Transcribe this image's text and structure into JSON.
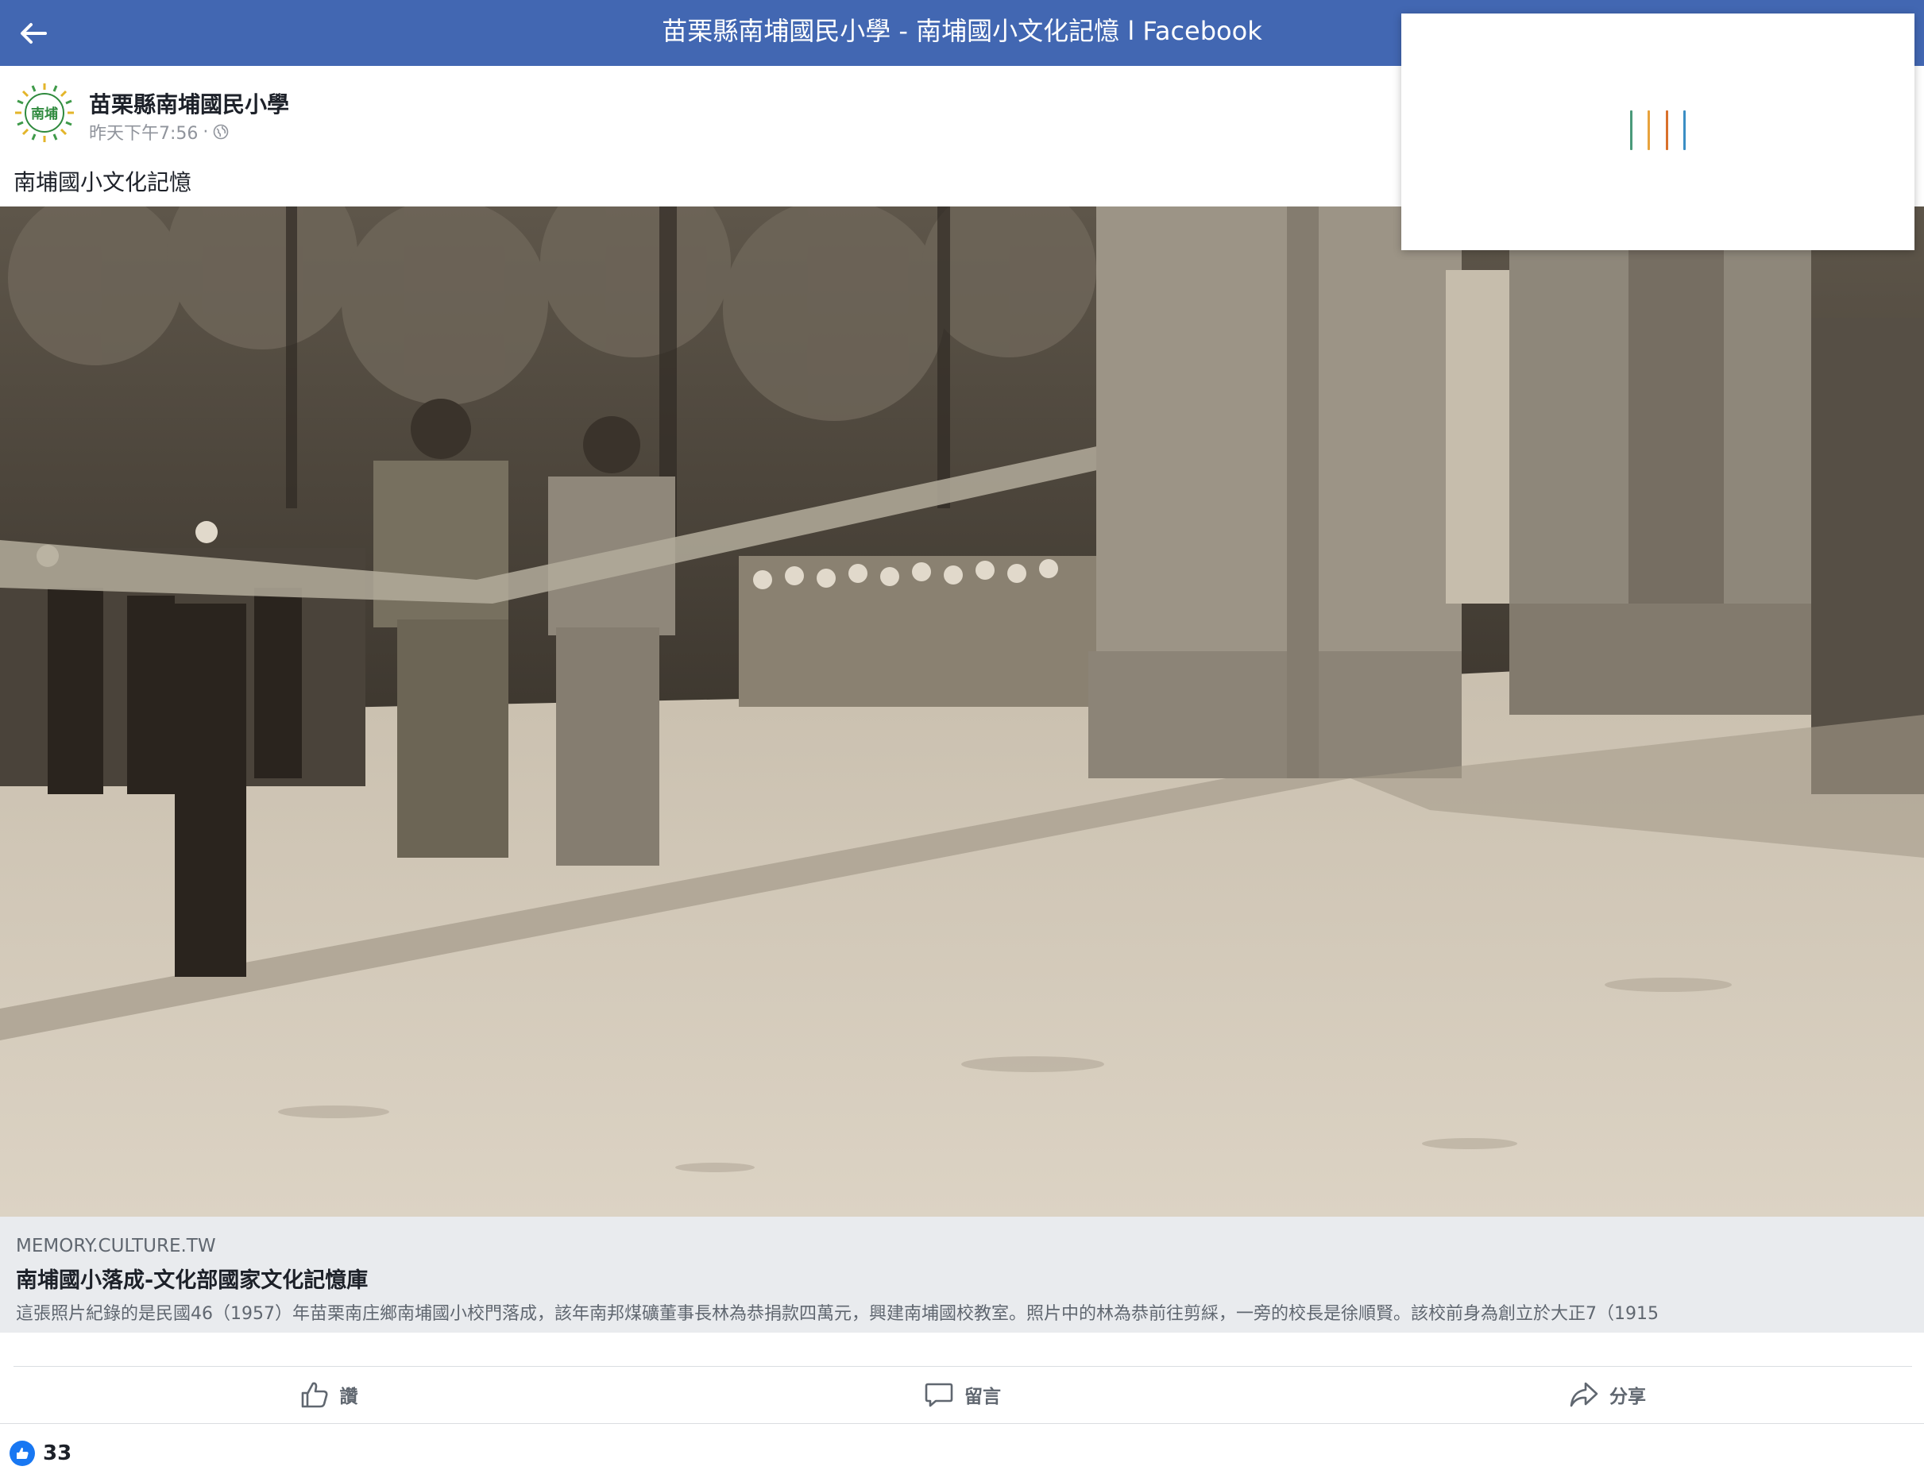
{
  "header": {
    "title": "苗栗縣南埔國民小學 - 南埔國小文化記憶 l Facebook",
    "back_icon": "arrow-left-icon",
    "bar_color": "#4267b2"
  },
  "post": {
    "page_name": "苗栗縣南埔國民小學",
    "timestamp": "昨天下午7:56",
    "separator": "·",
    "privacy_icon": "globe-icon",
    "avatar_text": "南埔",
    "text": "南埔國小文化記憶"
  },
  "link_preview": {
    "domain": "MEMORY.CULTURE.TW",
    "title": "南埔國小落成-文化部國家文化記憶庫",
    "description": "這張照片紀錄的是民國46（1957）年苗栗南庄鄉南埔國小校門落成，該年南邦煤礦董事長林為恭捐款四萬元，興建南埔國校教室。照片中的林為恭前往剪綵，一旁的校長是徐順賢。該校前身為創立於大正7（1915"
  },
  "actions": [
    {
      "label": "讚",
      "icon": "thumbs-up-icon"
    },
    {
      "label": "留言",
      "icon": "comment-icon"
    },
    {
      "label": "分享",
      "icon": "share-icon"
    }
  ],
  "reactions": {
    "count": "33",
    "icon": "like-reaction-icon",
    "color": "#1877f2"
  },
  "popup": {
    "spinner_colors": [
      "#4a9a7a",
      "#e8a33d",
      "#d9702b",
      "#3b8ec4"
    ]
  }
}
